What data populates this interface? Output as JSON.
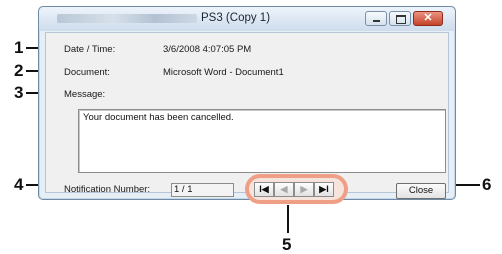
{
  "window": {
    "title": "PS3 (Copy 1)",
    "minimize_glyph": "",
    "maximize_glyph": "",
    "close_glyph": "✕"
  },
  "fields": {
    "date_label": "Date / Time:",
    "date_value": "3/6/2008 4:07:05 PM",
    "document_label": "Document:",
    "document_value": "Microsoft Word - Document1",
    "message_label": "Message:",
    "message_value": "Your document has been cancelled.",
    "notification_label": "Notification Number:",
    "notification_value": "1 / 1"
  },
  "nav": {
    "first": "I◀",
    "prev": "◀",
    "next": "▶",
    "last": "▶I"
  },
  "close_button": "Close",
  "callouts": {
    "c1": "1",
    "c2": "2",
    "c3": "3",
    "c4": "4",
    "c5": "5",
    "c6": "6"
  }
}
